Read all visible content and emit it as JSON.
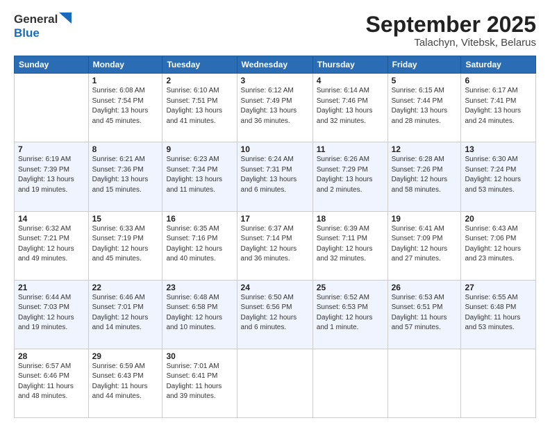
{
  "header": {
    "logo_general": "General",
    "logo_blue": "Blue",
    "title_month": "September 2025",
    "title_location": "Talachyn, Vitebsk, Belarus"
  },
  "weekdays": [
    "Sunday",
    "Monday",
    "Tuesday",
    "Wednesday",
    "Thursday",
    "Friday",
    "Saturday"
  ],
  "weeks": [
    [
      {
        "day": "",
        "info": ""
      },
      {
        "day": "1",
        "info": "Sunrise: 6:08 AM\nSunset: 7:54 PM\nDaylight: 13 hours\nand 45 minutes."
      },
      {
        "day": "2",
        "info": "Sunrise: 6:10 AM\nSunset: 7:51 PM\nDaylight: 13 hours\nand 41 minutes."
      },
      {
        "day": "3",
        "info": "Sunrise: 6:12 AM\nSunset: 7:49 PM\nDaylight: 13 hours\nand 36 minutes."
      },
      {
        "day": "4",
        "info": "Sunrise: 6:14 AM\nSunset: 7:46 PM\nDaylight: 13 hours\nand 32 minutes."
      },
      {
        "day": "5",
        "info": "Sunrise: 6:15 AM\nSunset: 7:44 PM\nDaylight: 13 hours\nand 28 minutes."
      },
      {
        "day": "6",
        "info": "Sunrise: 6:17 AM\nSunset: 7:41 PM\nDaylight: 13 hours\nand 24 minutes."
      }
    ],
    [
      {
        "day": "7",
        "info": "Sunrise: 6:19 AM\nSunset: 7:39 PM\nDaylight: 13 hours\nand 19 minutes."
      },
      {
        "day": "8",
        "info": "Sunrise: 6:21 AM\nSunset: 7:36 PM\nDaylight: 13 hours\nand 15 minutes."
      },
      {
        "day": "9",
        "info": "Sunrise: 6:23 AM\nSunset: 7:34 PM\nDaylight: 13 hours\nand 11 minutes."
      },
      {
        "day": "10",
        "info": "Sunrise: 6:24 AM\nSunset: 7:31 PM\nDaylight: 13 hours\nand 6 minutes."
      },
      {
        "day": "11",
        "info": "Sunrise: 6:26 AM\nSunset: 7:29 PM\nDaylight: 13 hours\nand 2 minutes."
      },
      {
        "day": "12",
        "info": "Sunrise: 6:28 AM\nSunset: 7:26 PM\nDaylight: 12 hours\nand 58 minutes."
      },
      {
        "day": "13",
        "info": "Sunrise: 6:30 AM\nSunset: 7:24 PM\nDaylight: 12 hours\nand 53 minutes."
      }
    ],
    [
      {
        "day": "14",
        "info": "Sunrise: 6:32 AM\nSunset: 7:21 PM\nDaylight: 12 hours\nand 49 minutes."
      },
      {
        "day": "15",
        "info": "Sunrise: 6:33 AM\nSunset: 7:19 PM\nDaylight: 12 hours\nand 45 minutes."
      },
      {
        "day": "16",
        "info": "Sunrise: 6:35 AM\nSunset: 7:16 PM\nDaylight: 12 hours\nand 40 minutes."
      },
      {
        "day": "17",
        "info": "Sunrise: 6:37 AM\nSunset: 7:14 PM\nDaylight: 12 hours\nand 36 minutes."
      },
      {
        "day": "18",
        "info": "Sunrise: 6:39 AM\nSunset: 7:11 PM\nDaylight: 12 hours\nand 32 minutes."
      },
      {
        "day": "19",
        "info": "Sunrise: 6:41 AM\nSunset: 7:09 PM\nDaylight: 12 hours\nand 27 minutes."
      },
      {
        "day": "20",
        "info": "Sunrise: 6:43 AM\nSunset: 7:06 PM\nDaylight: 12 hours\nand 23 minutes."
      }
    ],
    [
      {
        "day": "21",
        "info": "Sunrise: 6:44 AM\nSunset: 7:03 PM\nDaylight: 12 hours\nand 19 minutes."
      },
      {
        "day": "22",
        "info": "Sunrise: 6:46 AM\nSunset: 7:01 PM\nDaylight: 12 hours\nand 14 minutes."
      },
      {
        "day": "23",
        "info": "Sunrise: 6:48 AM\nSunset: 6:58 PM\nDaylight: 12 hours\nand 10 minutes."
      },
      {
        "day": "24",
        "info": "Sunrise: 6:50 AM\nSunset: 6:56 PM\nDaylight: 12 hours\nand 6 minutes."
      },
      {
        "day": "25",
        "info": "Sunrise: 6:52 AM\nSunset: 6:53 PM\nDaylight: 12 hours\nand 1 minute."
      },
      {
        "day": "26",
        "info": "Sunrise: 6:53 AM\nSunset: 6:51 PM\nDaylight: 11 hours\nand 57 minutes."
      },
      {
        "day": "27",
        "info": "Sunrise: 6:55 AM\nSunset: 6:48 PM\nDaylight: 11 hours\nand 53 minutes."
      }
    ],
    [
      {
        "day": "28",
        "info": "Sunrise: 6:57 AM\nSunset: 6:46 PM\nDaylight: 11 hours\nand 48 minutes."
      },
      {
        "day": "29",
        "info": "Sunrise: 6:59 AM\nSunset: 6:43 PM\nDaylight: 11 hours\nand 44 minutes."
      },
      {
        "day": "30",
        "info": "Sunrise: 7:01 AM\nSunset: 6:41 PM\nDaylight: 11 hours\nand 39 minutes."
      },
      {
        "day": "",
        "info": ""
      },
      {
        "day": "",
        "info": ""
      },
      {
        "day": "",
        "info": ""
      },
      {
        "day": "",
        "info": ""
      }
    ]
  ]
}
